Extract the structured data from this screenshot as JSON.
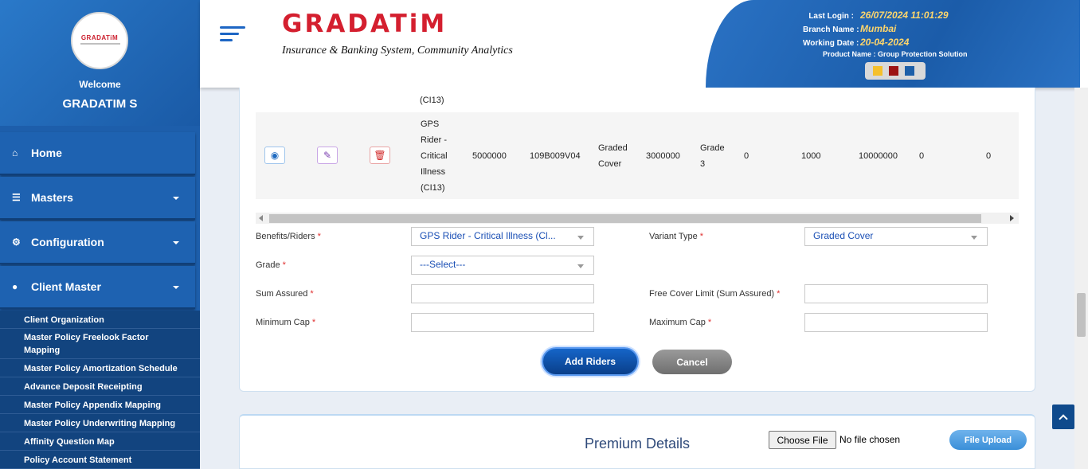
{
  "sidebar": {
    "logo_text": "GRADATiM",
    "welcome": "Welcome",
    "username": "GRADATIM S",
    "nav": [
      {
        "label": "Home",
        "icon": "home-icon",
        "has_caret": false
      },
      {
        "label": "Masters",
        "icon": "database-icon",
        "has_caret": true
      },
      {
        "label": "Configuration",
        "icon": "cogs-icon",
        "has_caret": true
      },
      {
        "label": "Client Master",
        "icon": "user-icon",
        "has_caret": true
      }
    ],
    "submenu": [
      "Client Organization",
      "Master Policy Freelook Factor Mapping",
      "Master Policy Amortization Schedule",
      "Advance Deposit Receipting",
      "Master Policy Appendix Mapping",
      "Master Policy Underwriting Mapping",
      "Affinity Question Map",
      "Policy Account Statement"
    ]
  },
  "header": {
    "brand_name": "GRADATiM",
    "brand_tagline": "Insurance & Banking System, Community Analytics",
    "last_login_label": "Last Login :",
    "last_login": "26/07/2024 11:01:29",
    "branch_label": "Branch Name :",
    "branch": "Mumbai",
    "working_date_label": "Working Date :",
    "working_date": "20-04-2024",
    "product_label": "Product Name : Group Protection Solution",
    "theme_colors": [
      "#f5c02c",
      "#9c1313",
      "#1d5fa8"
    ]
  },
  "table": {
    "prev_row_tail": "(CI13)",
    "row": {
      "benefit": [
        "GPS",
        "Rider -",
        "Critical",
        "Illness",
        "(CI13)"
      ],
      "sum_assured": "5000000",
      "code": "109B009V04",
      "variant": [
        "Graded",
        "Cover"
      ],
      "free_cover": "3000000",
      "grade": [
        "Grade",
        "3"
      ],
      "col_a": "0",
      "col_b": "1000",
      "col_c": "10000000",
      "col_d": "0",
      "col_e": "0"
    }
  },
  "form": {
    "benefits_label": "Benefits/Riders",
    "benefits_value": "GPS Rider - Critical Illness (Cl...",
    "variant_label": "Variant Type",
    "variant_value": "Graded Cover",
    "grade_label": "Grade",
    "grade_value": "---Select---",
    "sum_assured_label": "Sum Assured",
    "free_cover_label": "Free Cover Limit (Sum Assured)",
    "min_cap_label": "Minimum Cap",
    "max_cap_label": "Maximum Cap",
    "required_mark": "*",
    "add_button": "Add Riders",
    "cancel_button": "Cancel"
  },
  "premium": {
    "title": "Premium Details",
    "choose_file": "Choose File",
    "no_file": "No file chosen",
    "upload": "File Upload"
  }
}
